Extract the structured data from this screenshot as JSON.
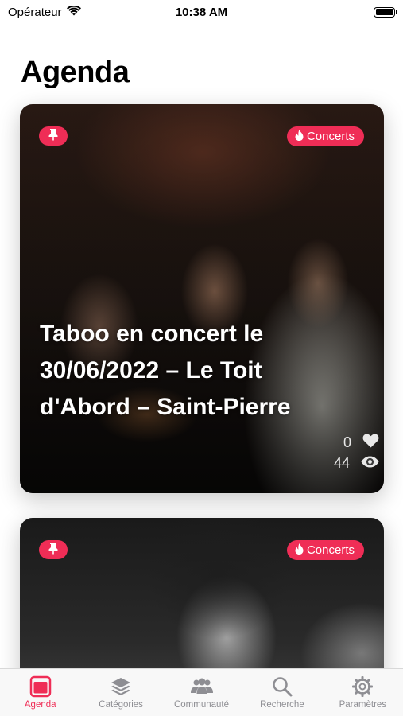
{
  "status_bar": {
    "carrier": "Opérateur",
    "time": "10:38 AM"
  },
  "page": {
    "title": "Agenda"
  },
  "colors": {
    "accent": "#ef2d56",
    "tab_inactive": "#8e8e93"
  },
  "events": [
    {
      "category": "Concerts",
      "category_icon": "flame-icon",
      "pinned": true,
      "title": "Taboo en concert le 30/06/2022 – Le Toit d'Abord – Saint-Pierre",
      "likes": "0",
      "views": "44"
    },
    {
      "category": "Concerts",
      "category_icon": "flame-icon",
      "pinned": true
    }
  ],
  "tabbar": {
    "items": [
      {
        "label": "Agenda",
        "icon": "agenda-icon",
        "active": true
      },
      {
        "label": "Catégories",
        "icon": "layers-icon",
        "active": false
      },
      {
        "label": "Communauté",
        "icon": "community-icon",
        "active": false
      },
      {
        "label": "Recherche",
        "icon": "search-icon",
        "active": false
      },
      {
        "label": "Paramètres",
        "icon": "gear-icon",
        "active": false
      }
    ]
  }
}
